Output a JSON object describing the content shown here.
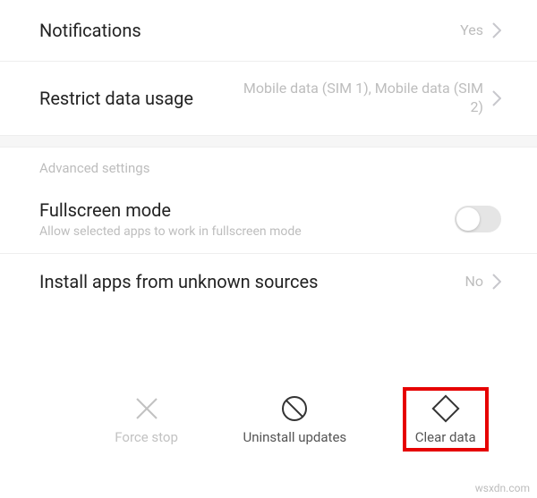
{
  "rows": {
    "notifications": {
      "title": "Notifications",
      "value": "Yes"
    },
    "restrict": {
      "title": "Restrict data usage",
      "value": "Mobile data (SIM 1), Mobile data (SIM 2)"
    },
    "advanced_header": "Advanced settings",
    "fullscreen": {
      "title": "Fullscreen mode",
      "subtitle": "Allow selected apps to work in fullscreen mode",
      "enabled": false
    },
    "install": {
      "title": "Install apps from unknown sources",
      "value": "No"
    }
  },
  "toolbar": {
    "force_stop": {
      "label": "Force stop",
      "icon": "close-icon"
    },
    "uninstall": {
      "label": "Uninstall updates",
      "icon": "prohibit-icon"
    },
    "clear_data": {
      "label": "Clear data",
      "icon": "eraser-icon"
    }
  },
  "footer": "wsxdn.com"
}
